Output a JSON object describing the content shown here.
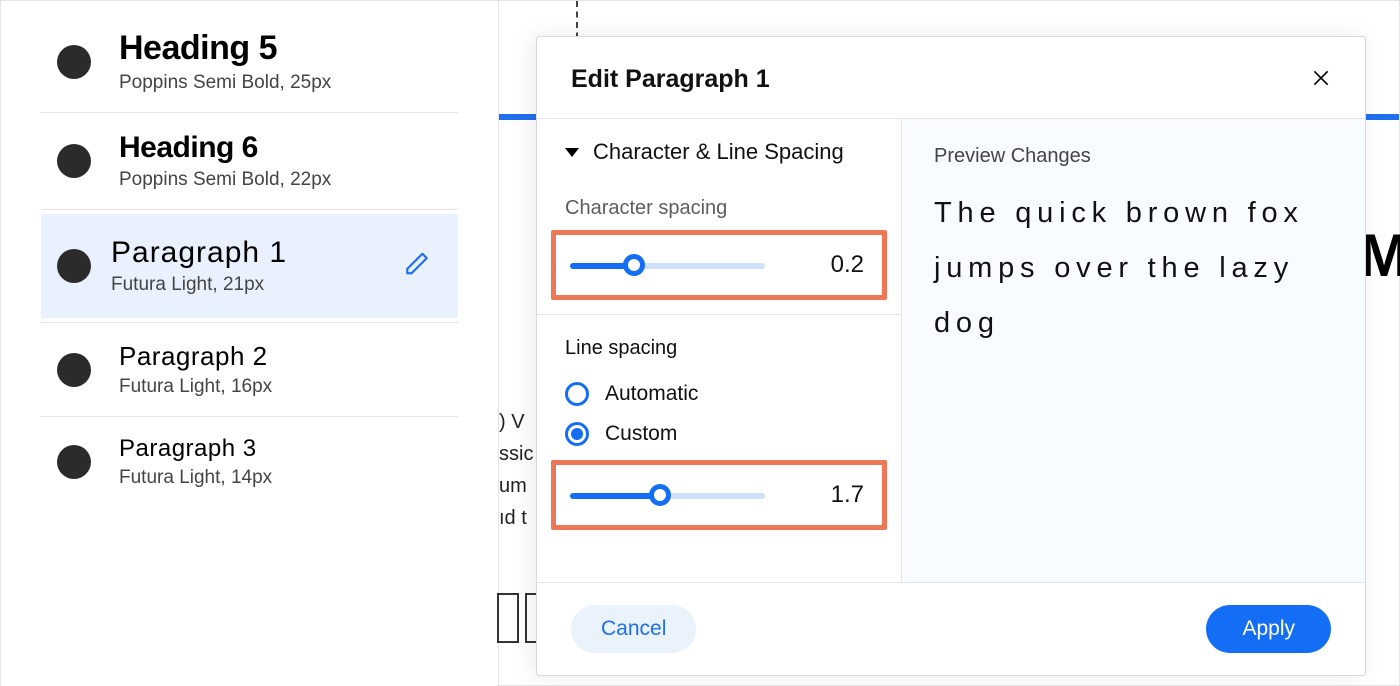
{
  "styles": [
    {
      "name": "Heading 5",
      "meta": "Poppins Semi Bold, 25px",
      "cls": "h5"
    },
    {
      "name": "Heading 6",
      "meta": "Poppins Semi Bold, 22px",
      "cls": "h6"
    },
    {
      "name": "Paragraph 1",
      "meta": "Futura Light, 21px",
      "cls": "p1",
      "selected": true
    },
    {
      "name": "Paragraph 2",
      "meta": "Futura Light, 16px",
      "cls": "p2"
    },
    {
      "name": "Paragraph 3",
      "meta": "Futura Light, 14px",
      "cls": "p3"
    }
  ],
  "dialog": {
    "title": "Edit Paragraph 1",
    "section": "Character & Line Spacing",
    "char_spacing": {
      "label": "Character spacing",
      "value_text": "0.2",
      "fill_pct": 33
    },
    "line_spacing": {
      "label": "Line spacing",
      "options": {
        "auto": "Automatic",
        "custom": "Custom"
      },
      "selected": "custom",
      "value_text": "1.7",
      "fill_pct": 46
    },
    "preview": {
      "label": "Preview Changes",
      "text": "The quick brown fox jumps over the lazy dog"
    },
    "buttons": {
      "cancel": "Cancel",
      "apply": "Apply"
    }
  },
  "bg_text": ") V\nssic\num\nıd t",
  "bg_big_letter": "M"
}
